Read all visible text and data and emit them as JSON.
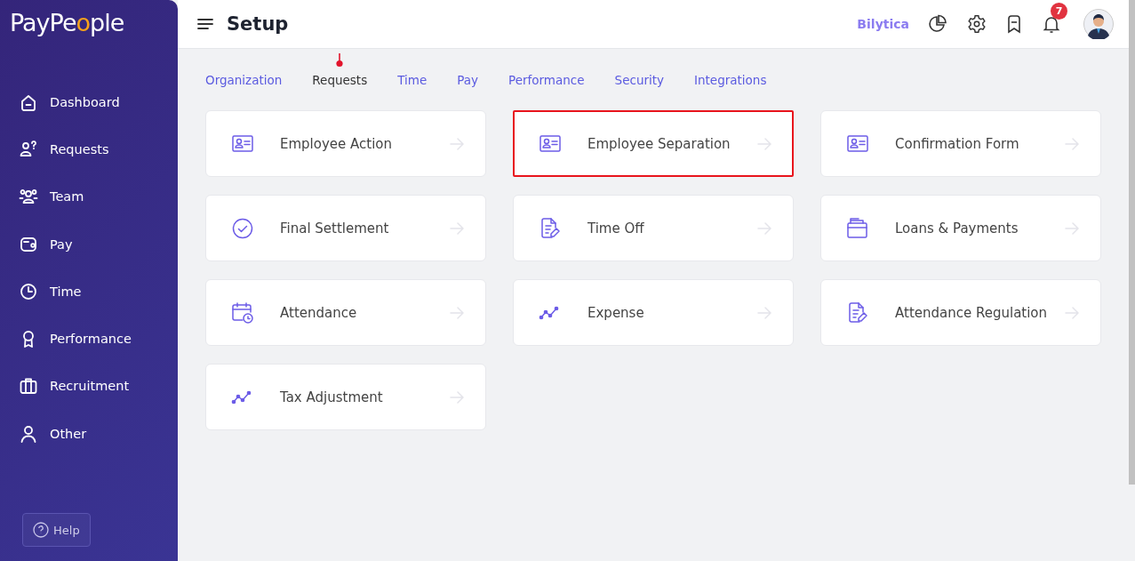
{
  "logo": {
    "before": "PayPe",
    "accent": "o",
    "after": "ple"
  },
  "sidebar": {
    "items": [
      {
        "label": "Dashboard",
        "kind": "home"
      },
      {
        "label": "Requests",
        "kind": "requests"
      },
      {
        "label": "Team",
        "kind": "team"
      },
      {
        "label": "Pay",
        "kind": "wallet"
      },
      {
        "label": "Time",
        "kind": "clock"
      },
      {
        "label": "Performance",
        "kind": "award"
      },
      {
        "label": "Recruitment",
        "kind": "briefcase"
      },
      {
        "label": "Other",
        "kind": "user"
      }
    ],
    "help": "Help"
  },
  "header": {
    "title": "Setup",
    "company": "Bilytica",
    "notifications": "7"
  },
  "tabs": [
    {
      "label": "Organization",
      "selected": false
    },
    {
      "label": "Requests",
      "selected": true
    },
    {
      "label": "Time",
      "selected": false
    },
    {
      "label": "Pay",
      "selected": false
    },
    {
      "label": "Performance",
      "selected": false
    },
    {
      "label": "Security",
      "selected": false
    },
    {
      "label": "Integrations",
      "selected": false
    }
  ],
  "cards": [
    {
      "label": "Employee Action",
      "kind": "idcard",
      "highlighted": false
    },
    {
      "label": "Employee Separation",
      "kind": "idcard",
      "highlighted": true
    },
    {
      "label": "Confirmation Form",
      "kind": "idcard",
      "highlighted": false
    },
    {
      "label": "Final Settlement",
      "kind": "check",
      "highlighted": false
    },
    {
      "label": "Time Off",
      "kind": "docedit",
      "highlighted": false
    },
    {
      "label": "Loans & Payments",
      "kind": "folder",
      "highlighted": false
    },
    {
      "label": "Attendance",
      "kind": "calendar",
      "highlighted": false
    },
    {
      "label": "Expense",
      "kind": "trend",
      "highlighted": false
    },
    {
      "label": "Attendance Regulation",
      "kind": "docedit",
      "highlighted": false
    },
    {
      "label": "Tax Adjustment",
      "kind": "trend",
      "highlighted": false
    }
  ]
}
